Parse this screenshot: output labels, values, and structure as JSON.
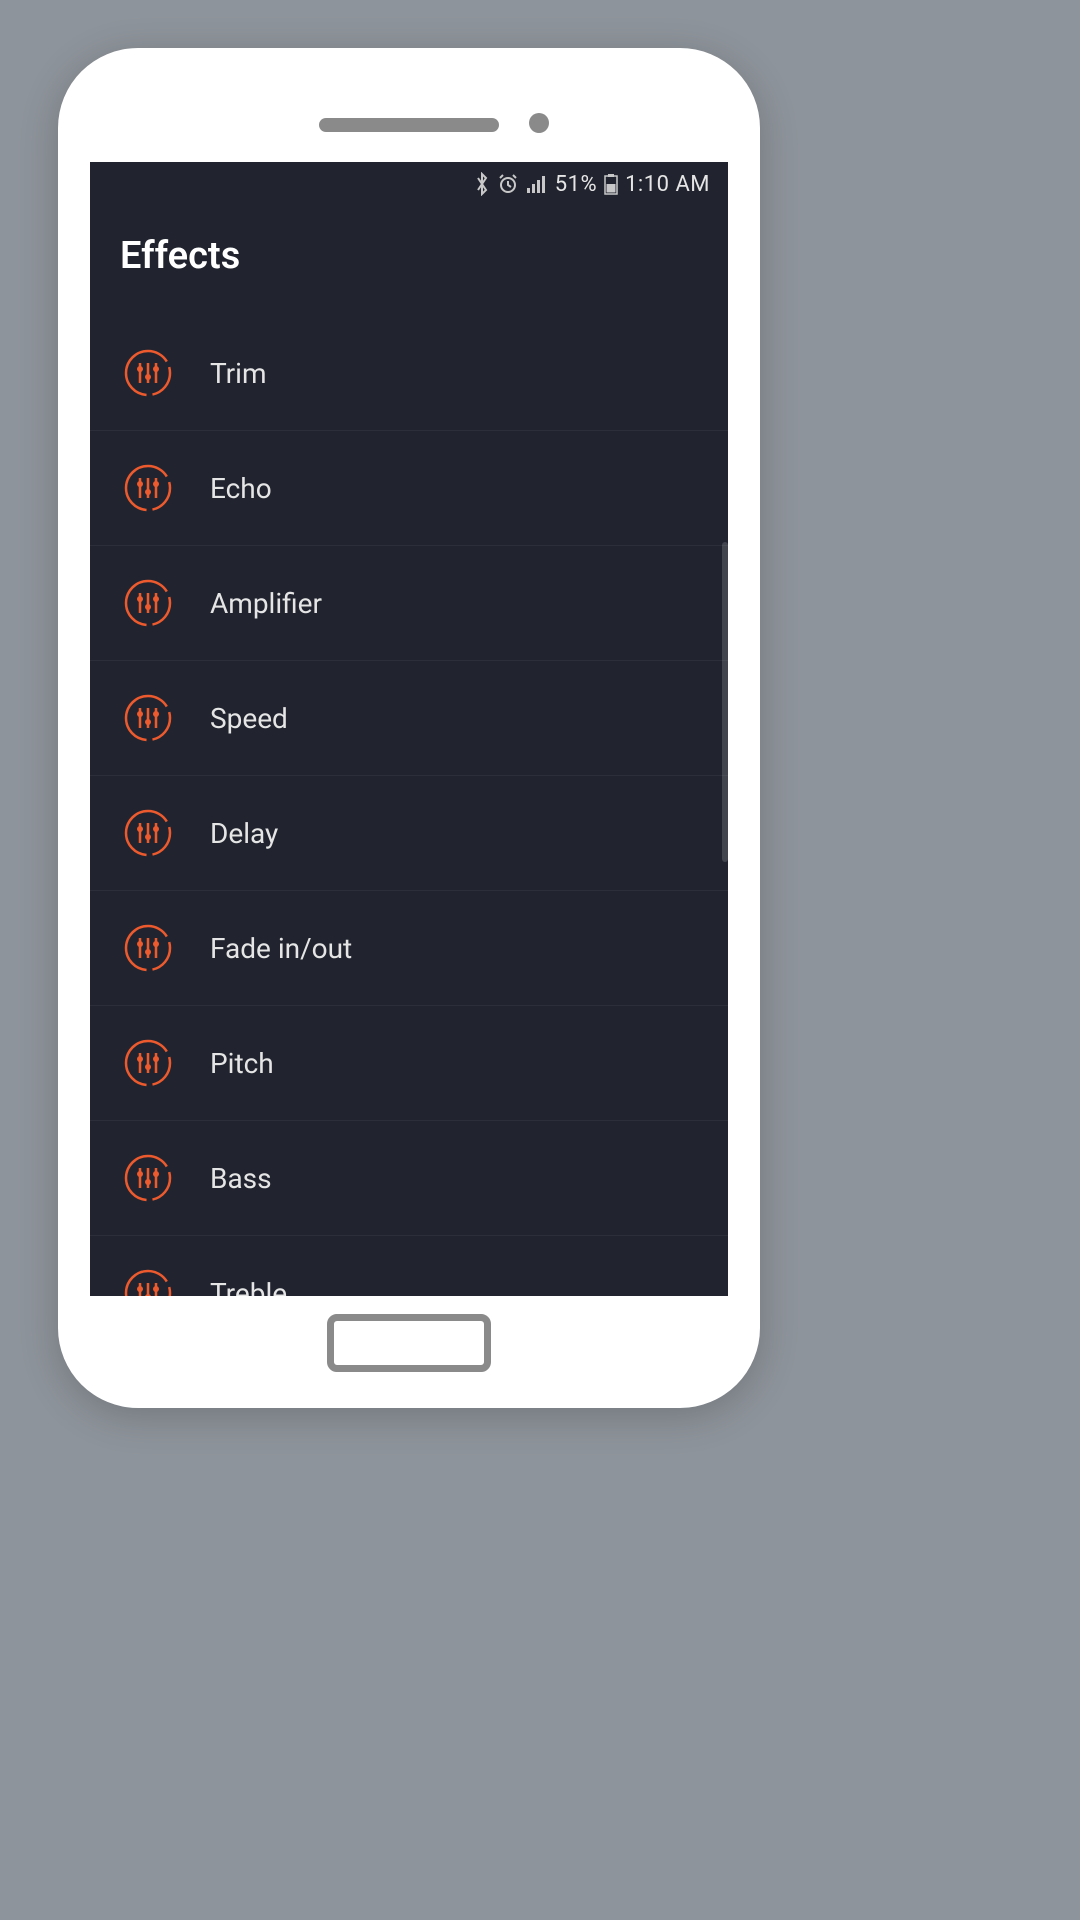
{
  "status_bar": {
    "battery_percent": "51%",
    "time": "1:10 AM"
  },
  "page": {
    "title": "Effects"
  },
  "effects": [
    {
      "label": "Trim",
      "name": "trim"
    },
    {
      "label": "Echo",
      "name": "echo"
    },
    {
      "label": "Amplifier",
      "name": "amplifier"
    },
    {
      "label": "Speed",
      "name": "speed"
    },
    {
      "label": "Delay",
      "name": "delay"
    },
    {
      "label": "Fade in/out",
      "name": "fade-in-out"
    },
    {
      "label": "Pitch",
      "name": "pitch"
    },
    {
      "label": "Bass",
      "name": "bass"
    },
    {
      "label": "Treble",
      "name": "treble"
    }
  ],
  "colors": {
    "accent": "#ed5a2e",
    "bg_dark": "#21242f",
    "frame_bg": "#8e949b"
  }
}
